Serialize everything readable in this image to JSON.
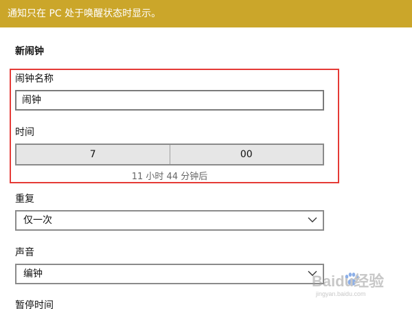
{
  "banner": {
    "text": "通知只在 PC 处于唤醒状态时显示。"
  },
  "form": {
    "title": "新闹钟",
    "alarm_name": {
      "label": "闹钟名称",
      "value": "闹钟"
    },
    "time": {
      "label": "时间",
      "hour": "7",
      "minute": "00",
      "hint": "11 小时 44 分钟后"
    },
    "repeat": {
      "label": "重复",
      "selected": "仅一次"
    },
    "sound": {
      "label": "声音",
      "selected": "编钟"
    },
    "snooze": {
      "label": "暂停时间"
    }
  },
  "watermark": {
    "brand": "Baidu经验",
    "url": "jingyan.baidu.com"
  },
  "colors": {
    "banner": "#cba62a",
    "highlight": "#e53935"
  },
  "icons": {
    "dropdown": "chevron-down-icon",
    "watermark_logo": "baidu-paw-icon"
  }
}
